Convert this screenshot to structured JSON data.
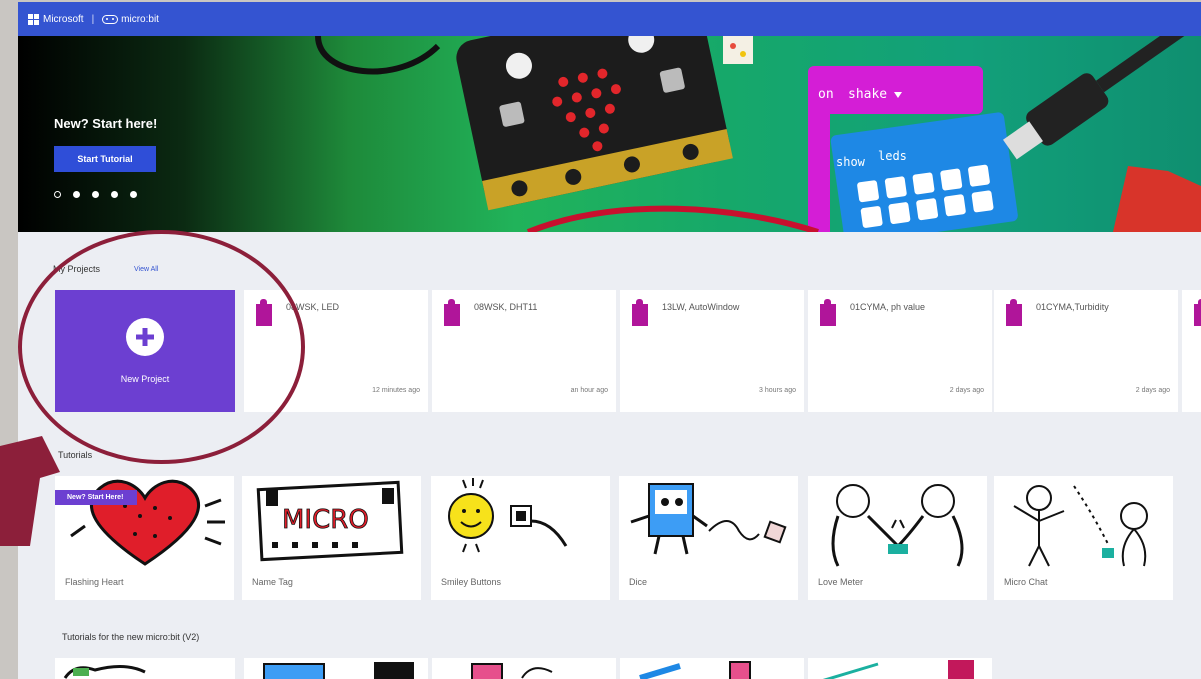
{
  "topbar": {
    "microsoft_label": "Microsoft",
    "separator": "|",
    "microbit_label": "micro:bit"
  },
  "hero": {
    "title": "New? Start here!",
    "button_label": "Start Tutorial",
    "block_on": "on",
    "block_shake": "shake",
    "block_show": "show",
    "block_leds": "leds",
    "carousel_count": 5,
    "carousel_active_index": 0
  },
  "my_projects": {
    "title": "My Projects",
    "view_all": "View All",
    "new_project_label": "New Project",
    "items": [
      {
        "name": "08WSK, LED",
        "time": "12 minutes ago"
      },
      {
        "name": "08WSK, DHT11",
        "time": "an hour ago"
      },
      {
        "name": "13LW, AutoWindow",
        "time": "3 hours ago"
      },
      {
        "name": "01CYMA, ph value",
        "time": "2 days ago"
      },
      {
        "name": "01CYMA,Turbidity",
        "time": "2 days ago"
      }
    ]
  },
  "tutorials": {
    "title": "Tutorials",
    "badge": "New? Start Here!",
    "items": [
      {
        "name": "Flashing Heart",
        "icon": "heart-icon"
      },
      {
        "name": "Name Tag",
        "icon": "name-tag-icon",
        "art_text": "MICRO"
      },
      {
        "name": "Smiley Buttons",
        "icon": "smiley-icon"
      },
      {
        "name": "Dice",
        "icon": "dice-icon"
      },
      {
        "name": "Love Meter",
        "icon": "love-meter-icon"
      },
      {
        "name": "Micro Chat",
        "icon": "chat-icon"
      }
    ]
  },
  "tutorials_v2": {
    "title": "Tutorials for the new micro:bit (V2)"
  },
  "colors": {
    "topbar": "#3454d1",
    "accent_purple": "#6c3fd1",
    "project_icon": "#b0159a",
    "annotation": "#8c1f3a"
  }
}
